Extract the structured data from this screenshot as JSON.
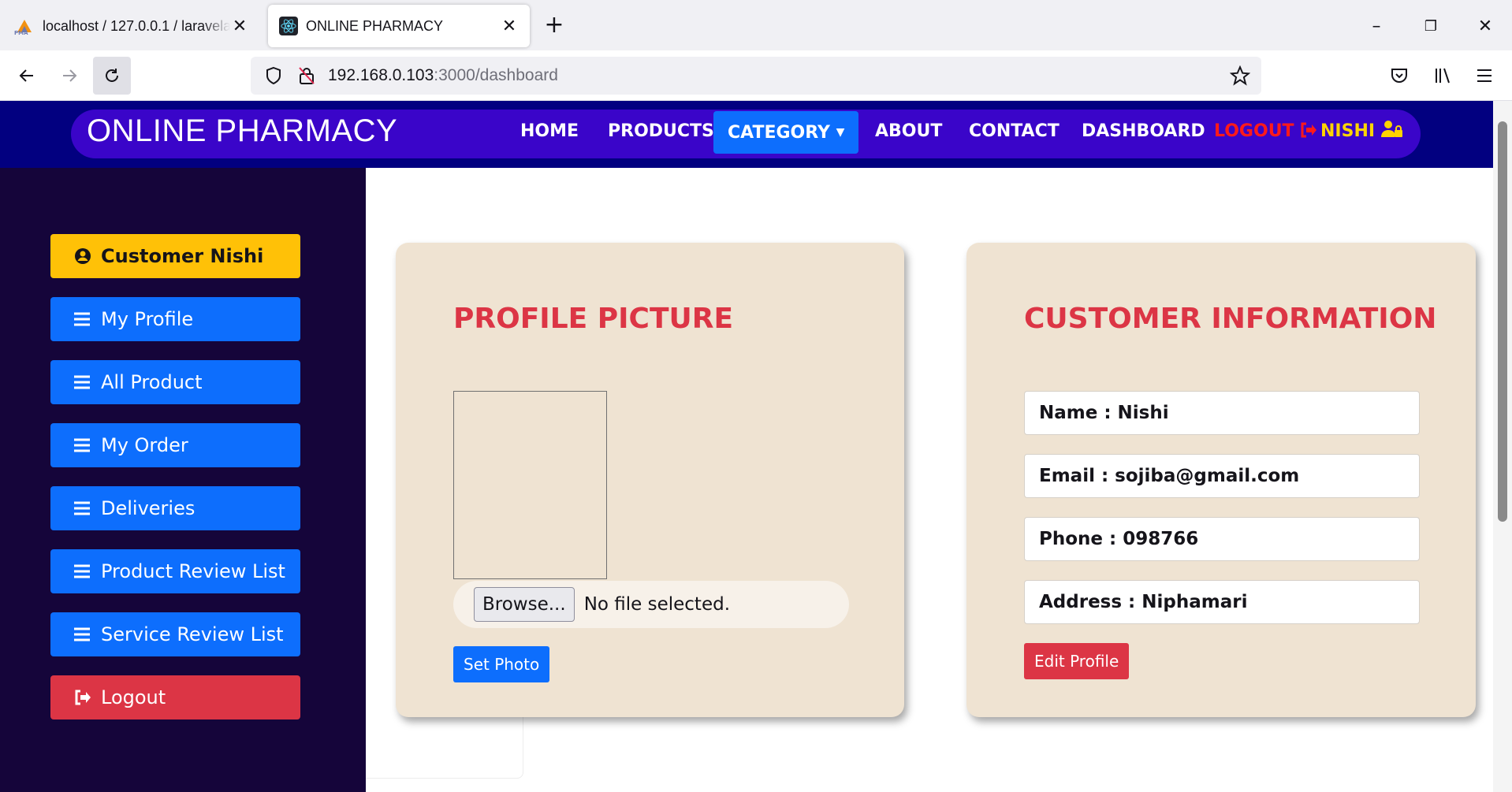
{
  "browser": {
    "tabs": [
      {
        "title": "localhost / 127.0.0.1 / laravelapi",
        "icon": "phpmyadmin-icon",
        "active": false
      },
      {
        "title": "ONLINE PHARMACY",
        "icon": "react-icon",
        "active": true
      }
    ],
    "url_host": "192.168.0.103",
    "url_rest": ":3000/dashboard"
  },
  "header": {
    "brand": "ONLINE PHARMACY",
    "menu": {
      "home": "HOME",
      "products": "PRODUCTS",
      "category": "CATEGORY",
      "about": "ABOUT",
      "contact": "CONTACT",
      "dashboard": "DASHBOARD",
      "logout": "LOGOUT",
      "user": "NISHI"
    }
  },
  "sidebar": {
    "user_label": "Customer Nishi",
    "items": [
      {
        "label": "My Profile"
      },
      {
        "label": "All Product"
      },
      {
        "label": "My Order"
      },
      {
        "label": "Deliveries"
      },
      {
        "label": "Product Review List"
      },
      {
        "label": "Service Review List"
      }
    ],
    "logout": "Logout"
  },
  "profile_card": {
    "title": "PROFILE PICTURE",
    "browse_label": "Browse...",
    "file_status": "No file selected.",
    "set_photo": "Set Photo"
  },
  "info_card": {
    "title": "CUSTOMER INFORMATION",
    "name": "Name : Nishi",
    "email": "Email : sojiba@gmail.com",
    "phone": "Phone : 098766",
    "address": "Address : Niphamari",
    "edit": "Edit Profile"
  },
  "colors": {
    "header_bg": "#020080",
    "header_pill": "#3a05c9",
    "sidebar_bg": "#15053a",
    "primary": "#0d6efd",
    "warning": "#ffc107",
    "danger": "#dc3545",
    "card_bg": "#efe3d2"
  }
}
